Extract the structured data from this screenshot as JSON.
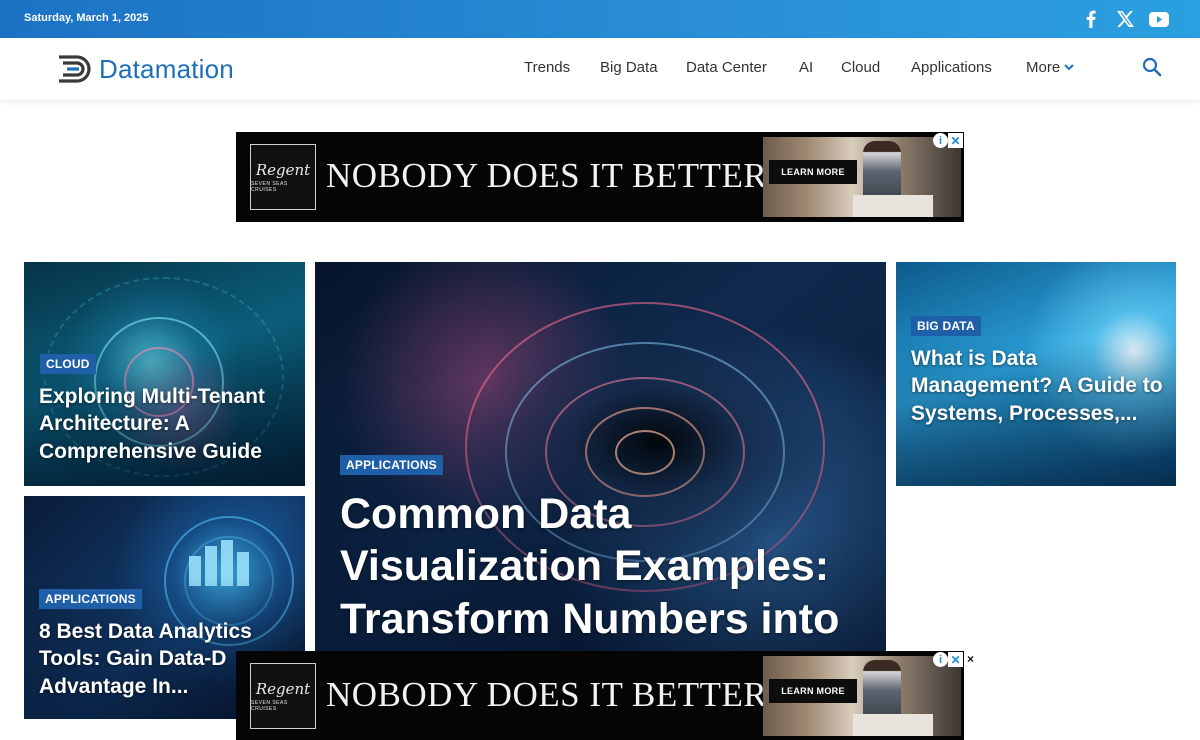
{
  "topbar": {
    "date": "Saturday, March 1, 2025",
    "social": [
      {
        "icon": "facebook-icon"
      },
      {
        "icon": "x-twitter-icon"
      },
      {
        "icon": "youtube-icon"
      }
    ]
  },
  "header": {
    "logo_text": "Datamation",
    "nav": [
      "Trends",
      "Big Data",
      "Data Center",
      "AI",
      "Cloud",
      "Applications",
      "More"
    ],
    "search_icon": "search-icon"
  },
  "ad": {
    "brand_script": "Regent",
    "brand_small": "SEVEN SEAS CRUISES",
    "headline": "NOBODY DOES IT BETTER™",
    "cta": "LEARN MORE",
    "info_icon": "i",
    "close_icon": "✕",
    "dismiss": "×"
  },
  "cards": [
    {
      "category": "CLOUD",
      "title": "Exploring Multi-Tenant Architecture: A Comprehensive Guide"
    },
    {
      "category": "APPLICATIONS",
      "title": "8 Best Data Analytics Tools: Gain Data-D Advantage In..."
    },
    {
      "category": "APPLICATIONS",
      "title": "Common Data Visualization Examples: Transform Numbers into"
    },
    {
      "category": "BIG DATA",
      "title": "What is Data Management? A Guide to Systems, Processes,..."
    }
  ],
  "colors": {
    "topbar": "#2a8fd6",
    "brand": "#1e6fb8",
    "badge": "#1e5fa8"
  }
}
